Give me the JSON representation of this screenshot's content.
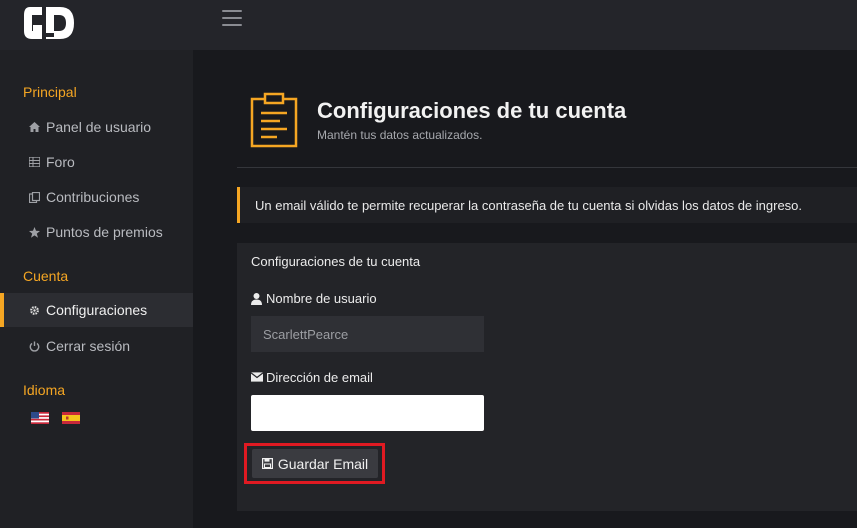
{
  "brand": {
    "logo_text": "GD",
    "accent": "#f5a623",
    "highlight": "#e01a22"
  },
  "sidebar": {
    "sections": [
      {
        "title": "Principal"
      },
      {
        "title": "Cuenta"
      },
      {
        "title": "Idioma"
      }
    ],
    "items": [
      {
        "label": "Panel de usuario",
        "icon": "home-icon"
      },
      {
        "label": "Foro",
        "icon": "grid-icon"
      },
      {
        "label": "Contribuciones",
        "icon": "contributions-icon"
      },
      {
        "label": "Puntos de premios",
        "icon": "star-icon"
      },
      {
        "label": "Configuraciones",
        "icon": "gear-icon",
        "active": true
      },
      {
        "label": "Cerrar sesión",
        "icon": "power-icon"
      }
    ],
    "languages": [
      "us-flag-icon",
      "es-flag-icon"
    ]
  },
  "header": {
    "title": "Configuraciones de tu cuenta",
    "subtitle": "Mantén tus datos actualizados.",
    "icon": "clipboard-icon"
  },
  "alert": {
    "text": "Un email válido te permite recuperar la contraseña de tu cuenta si olvidas los datos de ingreso."
  },
  "form": {
    "title": "Configuraciones de tu cuenta",
    "username_label": "Nombre de usuario",
    "username_value": "ScarlettPearce",
    "email_label": "Dirección de email",
    "email_value": "",
    "save_label": "Guardar Email"
  }
}
